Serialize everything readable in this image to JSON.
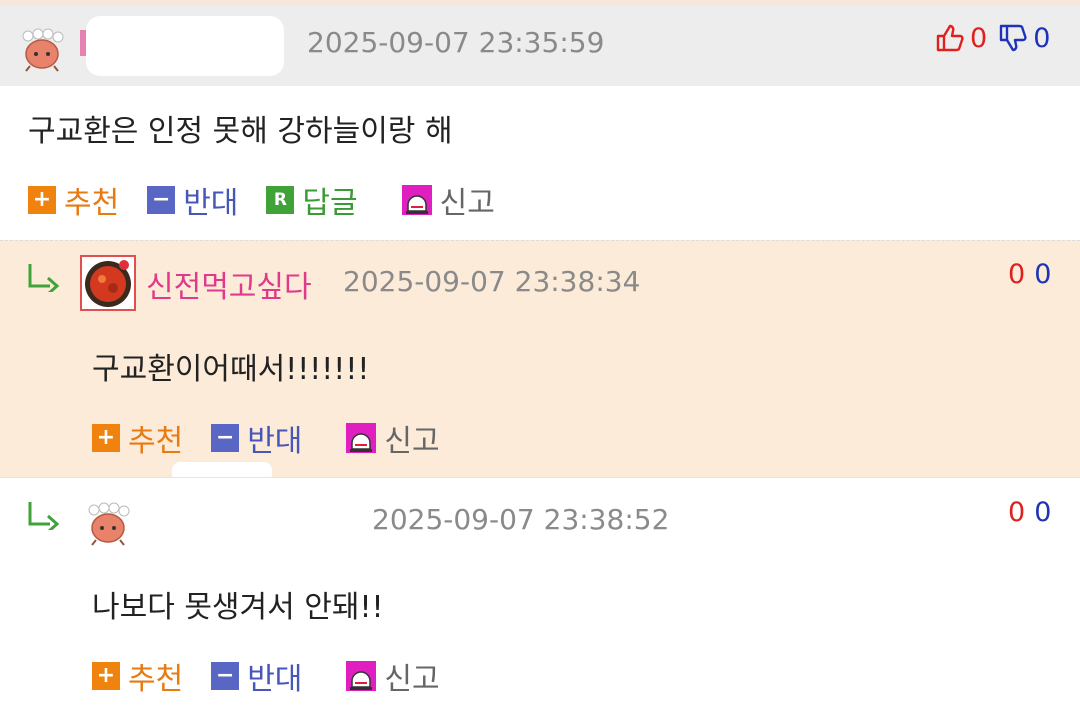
{
  "comment1": {
    "timestamp": "2025-09-07 23:35:59",
    "likes": "0",
    "dislikes": "0",
    "text": "구교환은 인정 못해 강하늘이랑 해",
    "actions": {
      "recommend": "추천",
      "oppose": "반대",
      "reply": "답글",
      "report": "신고"
    }
  },
  "reply1": {
    "nickname": "신전먹고싶다",
    "timestamp": "2025-09-07 23:38:34",
    "likes": "0",
    "dislikes": "0",
    "text": "구교환이어때서!!!!!!!",
    "actions": {
      "recommend": "추천",
      "oppose": "반대",
      "report": "신고"
    }
  },
  "reply2": {
    "timestamp": "2025-09-07 23:38:52",
    "likes": "0",
    "dislikes": "0",
    "text": "나보다 못생겨서 안돼!!",
    "actions": {
      "recommend": "추천",
      "oppose": "반대",
      "report": "신고"
    }
  },
  "colors": {
    "like": "#e0201d",
    "dislike": "#1f33b8",
    "recommend": "#f0820e",
    "oppose": "#5a66c4",
    "reply": "#3fa33a",
    "report": "#e01fc0"
  },
  "icons": {
    "thumbs_up": "thumbs-up-icon",
    "thumbs_down": "thumbs-down-icon",
    "reply_arrow": "reply-arrow-icon",
    "siren": "siren-icon"
  }
}
